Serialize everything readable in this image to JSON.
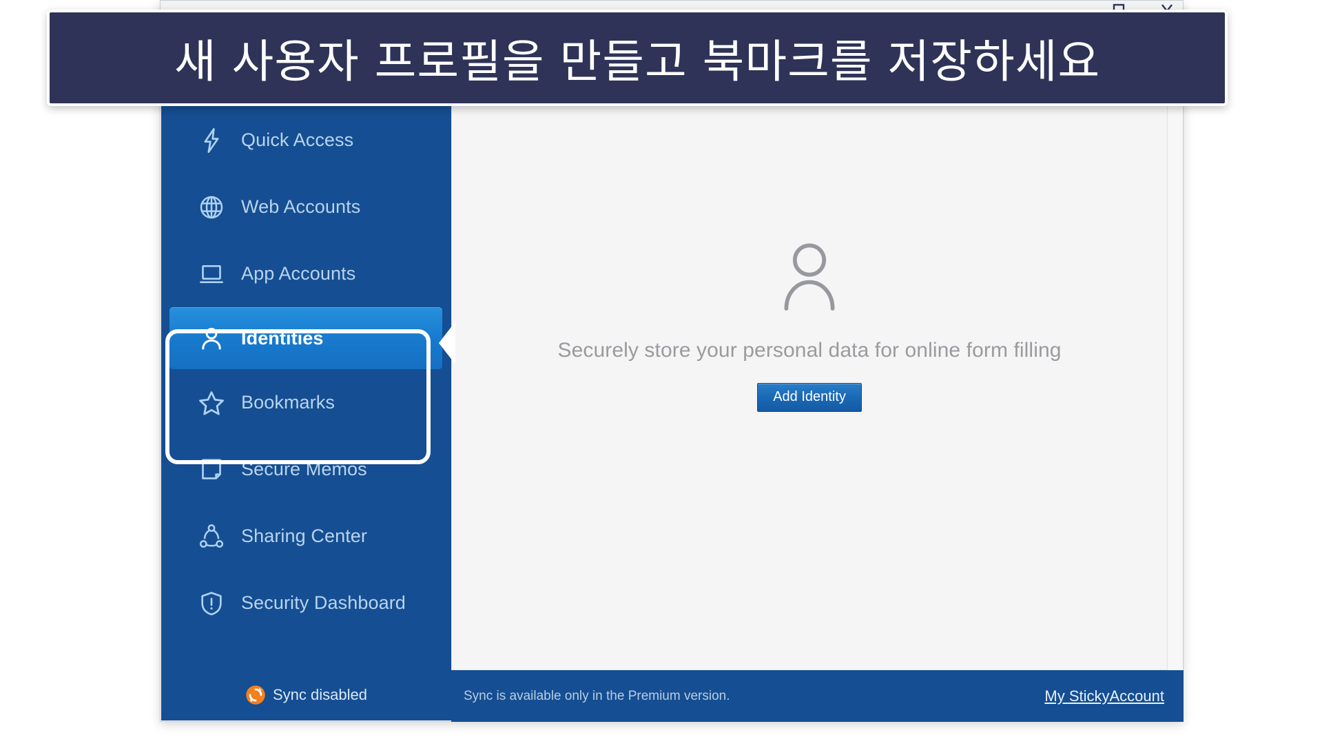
{
  "overlay": {
    "instruction": "새 사용자 프로필을 만들고 북마크를 저장하세요"
  },
  "window": {
    "controls": [
      {
        "name": "maximize",
        "icon": "maximize-icon"
      },
      {
        "name": "close",
        "icon": "close-icon"
      }
    ]
  },
  "sidebar": {
    "items": [
      {
        "label": "Quick Access",
        "icon": "lightning-bolt-icon",
        "active": false
      },
      {
        "label": "Web Accounts",
        "icon": "globe-icon",
        "active": false
      },
      {
        "label": "App Accounts",
        "icon": "laptop-icon",
        "active": false
      },
      {
        "label": "Identities",
        "icon": "person-icon",
        "active": true
      },
      {
        "label": "Bookmarks",
        "icon": "star-icon",
        "active": false
      },
      {
        "label": "Secure Memos",
        "icon": "note-icon",
        "active": false
      },
      {
        "label": "Sharing Center",
        "icon": "share-network-icon",
        "active": false
      },
      {
        "label": "Security Dashboard",
        "icon": "shield-alert-icon",
        "active": false
      }
    ],
    "sync": {
      "label": "Sync disabled",
      "icon": "sync-icon",
      "color": "#f28020"
    }
  },
  "main": {
    "empty_state": {
      "icon": "person-outline-icon",
      "message": "Securely store your personal data for online form filling",
      "button_label": "Add Identity"
    }
  },
  "statusbar": {
    "message": "Sync is available only in the Premium version.",
    "link_label": "My StickyAccount"
  },
  "colors": {
    "sidebar_bg": "#154e92",
    "active_item": "#1b7fd4",
    "banner_bg": "#2e3357",
    "content_bg": "#f5f5f6",
    "accent_orange": "#f28020"
  }
}
